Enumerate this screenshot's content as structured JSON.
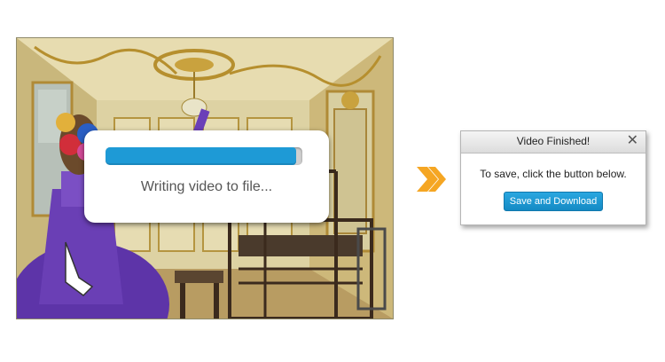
{
  "progress_dialog": {
    "status_text": "Writing video to file...",
    "progress_fraction": 0.97,
    "progress_color": "#1e9ad6"
  },
  "arrow": {
    "icon": "double-chevron-right-icon",
    "color": "#f5a623"
  },
  "finished_dialog": {
    "title": "Video Finished!",
    "close_icon": "close-icon",
    "message": "To save, click the button below.",
    "save_button_label": "Save and Download",
    "button_color": "#1e9ad6"
  }
}
